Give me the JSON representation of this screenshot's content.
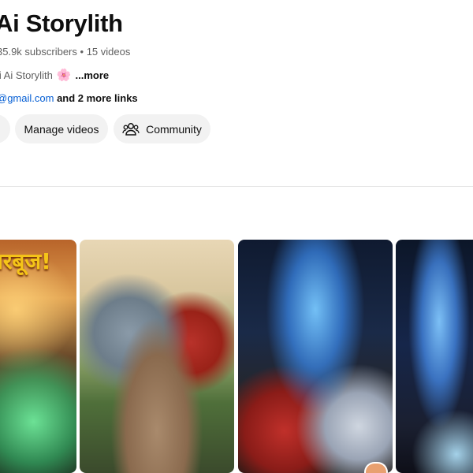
{
  "channel": {
    "name": "Ai Storylith",
    "subscribers": "35.9k subscribers",
    "separator": "•",
    "videos": "15 videos",
    "description_prefix": "li Ai Storylith",
    "description_more": "...more",
    "email_partial": "@gmail.com",
    "more_links": "and 2 more links"
  },
  "buttons": {
    "manage_videos": "Manage videos",
    "community": "Community"
  },
  "shorts": [
    {
      "overlay_text": "तरबूज!",
      "icon": "shorts-thumbnail"
    },
    {
      "icon": "shorts-thumbnail"
    },
    {
      "icon": "shorts-thumbnail"
    },
    {
      "icon": "shorts-thumbnail"
    }
  ],
  "colors": {
    "link": "#065fd4",
    "button_bg": "#f2f2f2",
    "secondary_text": "#606060"
  }
}
